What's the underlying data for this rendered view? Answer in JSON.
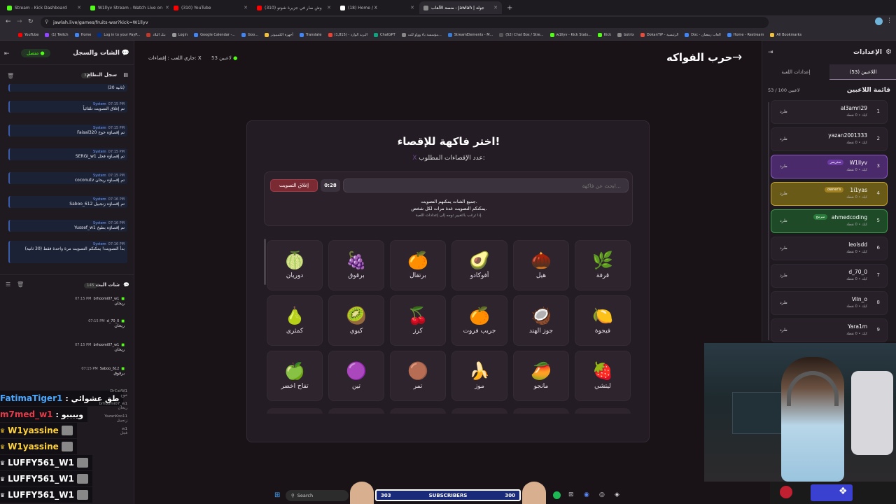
{
  "browser": {
    "tabs": [
      {
        "label": "Stream - Kick Dashboard",
        "color": "#53fc18"
      },
      {
        "label": "W1llyv Stream - Watch Live on",
        "color": "#53fc18"
      },
      {
        "label": "(310) YouTube",
        "color": "#ff0000"
      },
      {
        "label": "(310) وش صار في جزيرة شوتو",
        "color": "#ff0000"
      },
      {
        "label": "(18) Home / X",
        "color": "#ffffff"
      },
      {
        "label": "منصة الألعاب - Jawlah | جولة",
        "color": "#888888"
      }
    ],
    "url": "jawlah.live/games/fruits-war?kick=W1llyv",
    "bookmarks": [
      "YouTube",
      "(1) Twitch",
      "Home",
      "Log in to your PayP...",
      "بنك البلاد",
      "Login",
      "Google Calendar -...",
      "Goo...",
      "أجهزة الكمبيوتر",
      "Translate",
      "البريد الوارد - (1,815)",
      "ChatGPT",
      "مؤسسة ياء وواو للت...",
      "StreamElements - M...",
      "(52) Chat Box / Stre...",
      "w1llyv - Kick Stats...",
      "Kick",
      "botrix",
      "DokanTiP - الرئيسية",
      "Doc - العاب رمضان",
      "Home - Restream",
      "All Bookmarks"
    ]
  },
  "left_panel": {
    "title": "الشات والسجل",
    "status": "متصل",
    "system_log": {
      "title": "سجل النظام",
      "count": "32"
    },
    "log_messages": [
      {
        "time": "",
        "text": "(30 ثانية)"
      },
      {
        "time": "07:15 PM",
        "sender": "System",
        "text": "تم إغلاق التصويت تلقائياً"
      },
      {
        "time": "07:15 PM",
        "sender": "System",
        "text": "Faisal320 تم إقصاؤه خوخ"
      },
      {
        "time": "07:15 PM",
        "sender": "System",
        "text": "SERGI_w1 تم إقصاؤه فجل"
      },
      {
        "time": "07:15 PM",
        "sender": "System",
        "text": "coconutv تم إقصاؤه ريحان"
      },
      {
        "time": "07:16 PM",
        "sender": "System",
        "text": "Saboo_612 تم إقصاؤه زنجبيل"
      },
      {
        "time": "07:16 PM",
        "sender": "System",
        "text": "Yussef_w1 تم إقصاؤه بطيخ"
      },
      {
        "time": "07:16 PM",
        "sender": "System",
        "text": "بدأ التصويت! يمكنكم التصويت مرة واحدة فقط (30 ثانية)"
      }
    ],
    "stream_chat": {
      "title": "شات البث",
      "count": "145"
    },
    "chat_messages": [
      {
        "time": "07:15 PM",
        "user": "brhoomi07_w1",
        "text": "ريحان"
      },
      {
        "time": "07:15 PM",
        "user": "d_70_0",
        "text": "ريحان"
      },
      {
        "time": "07:15 PM",
        "user": "brhoomi07_w1",
        "text": "ريحان"
      },
      {
        "time": "07:15 PM",
        "user": "Saboo_612",
        "text": "برقوق"
      },
      {
        "time": "",
        "user": "DrCatW1",
        "text": "خوخ"
      },
      {
        "time": "",
        "user": "brhoomi07_w1",
        "text": "ريحان"
      },
      {
        "time": "",
        "user": "YazanKoo11",
        "text": "زنجبيل"
      },
      {
        "time": "",
        "user": "w1",
        "text": "فجل"
      }
    ]
  },
  "stream_overlay": [
    {
      "user": "FatimaTiger1",
      "text": "طق عشوائي",
      "color": "#4aa8ff"
    },
    {
      "user": "m7med_w1",
      "text": "ويبببو",
      "color": "#e23b4a"
    },
    {
      "user": "W1yassine",
      "text": "",
      "color": "#ffd23a"
    },
    {
      "user": "W1yassine",
      "text": "",
      "color": "#ffd23a"
    },
    {
      "user": "LUFFY561_W1",
      "text": "",
      "color": "#ffffff"
    },
    {
      "user": "LUFFY561_W1",
      "text": "",
      "color": "#ffffff"
    },
    {
      "user": "LUFFY561_W1",
      "text": "",
      "color": "#ffffff"
    }
  ],
  "header": {
    "playing_status": "جاري اللعب : إقصاءات: X",
    "players_count": "53 لاعبين",
    "game_title": "حرب الفواكه"
  },
  "game_card": {
    "title": "اختر فاكهة للإقصاء!",
    "subtitle": "عدد الإقصاءات المطلوب:",
    "subtitle_value": "X",
    "search_placeholder": "ابحث عن فاكهة...",
    "timer": "0:28",
    "close_vote_label": "إغلاق التصويت",
    "note_line1": "جميع الشات يمكنهم التصويت.",
    "note_line2": "يمكنكم التصويت عدة مرات لكل شخص.",
    "note_line3": "إذا ترغب بالتغيير توجه إلى إعدادات اللعبة."
  },
  "fruits": [
    {
      "name": "قرفة",
      "icon": "🌿",
      "color": "#c07040"
    },
    {
      "name": "هيل",
      "icon": "🌰",
      "color": "#a0a040"
    },
    {
      "name": "أفوكادو",
      "icon": "🥑",
      "color": "#6ba03a"
    },
    {
      "name": "برتقال",
      "icon": "🍊",
      "color": "#f08020"
    },
    {
      "name": "برقوق",
      "icon": "🍇",
      "color": "#7a3a8a"
    },
    {
      "name": "دوريان",
      "icon": "🍈",
      "color": "#a8c040"
    },
    {
      "name": "فيجوة",
      "icon": "🍋",
      "color": "#a0d040"
    },
    {
      "name": "جوز الهند",
      "icon": "🥥",
      "color": "#e0e0e0"
    },
    {
      "name": "جريب فروت",
      "icon": "🍊",
      "color": "#f0a030"
    },
    {
      "name": "كرز",
      "icon": "🍒",
      "color": "#d02030"
    },
    {
      "name": "كيوي",
      "icon": "🥝",
      "color": "#80b040"
    },
    {
      "name": "كمثرى",
      "icon": "🍐",
      "color": "#d0d050"
    },
    {
      "name": "ليتشي",
      "icon": "🍓",
      "color": "#e04050"
    },
    {
      "name": "مانجو",
      "icon": "🥭",
      "color": "#f0b030"
    },
    {
      "name": "موز",
      "icon": "🍌",
      "color": "#f0d040"
    },
    {
      "name": "تمر",
      "icon": "🟤",
      "color": "#6a2a20"
    },
    {
      "name": "تين",
      "icon": "🟣",
      "color": "#7a3a5a"
    },
    {
      "name": "تفاح اخضر",
      "icon": "🍏",
      "color": "#80d040"
    }
  ],
  "right_panel": {
    "title": "الإعدادات",
    "tab_players": "اللاعبين (53)",
    "tab_settings": "إعدادات اللعبة",
    "list_title": "قائمة اللاعبين",
    "list_count": "53 / 100 لاعبين",
    "kick_label": "طرد",
    "players": [
      {
        "rank": "1",
        "name": "al3amri29",
        "sub": "كيك • 0 نقطة",
        "badge": "",
        "style": "normal"
      },
      {
        "rank": "2",
        "name": "yazan2001333",
        "sub": "كيك • 0 نقطة",
        "badge": "",
        "style": "normal"
      },
      {
        "rank": "3",
        "name": "W1llyv",
        "sub": "كيك • 0 نقطة",
        "badge": "ستريمر",
        "style": "purple"
      },
      {
        "rank": "4",
        "name": "1i1yas",
        "sub": "كيك • 0 نقطة",
        "badge": "owner's",
        "style": "gold"
      },
      {
        "rank": "5",
        "name": "ahmedcoding",
        "sub": "كيك • 0 نقطة",
        "badge": "مبرمج",
        "style": "green"
      },
      {
        "rank": "6",
        "name": "leolsdd",
        "sub": "كيك • 0 نقطة",
        "badge": "",
        "style": "normal"
      },
      {
        "rank": "7",
        "name": "d_70_0",
        "sub": "كيك • 0 نقطة",
        "badge": "",
        "style": "normal"
      },
      {
        "rank": "8",
        "name": "Viln_o",
        "sub": "كيك • 0 نقطة",
        "badge": "",
        "style": "normal"
      },
      {
        "rank": "9",
        "name": "Yara1m",
        "sub": "كيك • 0 نقطة",
        "badge": "",
        "style": "normal"
      }
    ]
  },
  "subscribers_bar": {
    "current": "303",
    "label": "SUBSCRIBERS",
    "goal": "300"
  },
  "taskbar": {
    "search": "Search"
  }
}
